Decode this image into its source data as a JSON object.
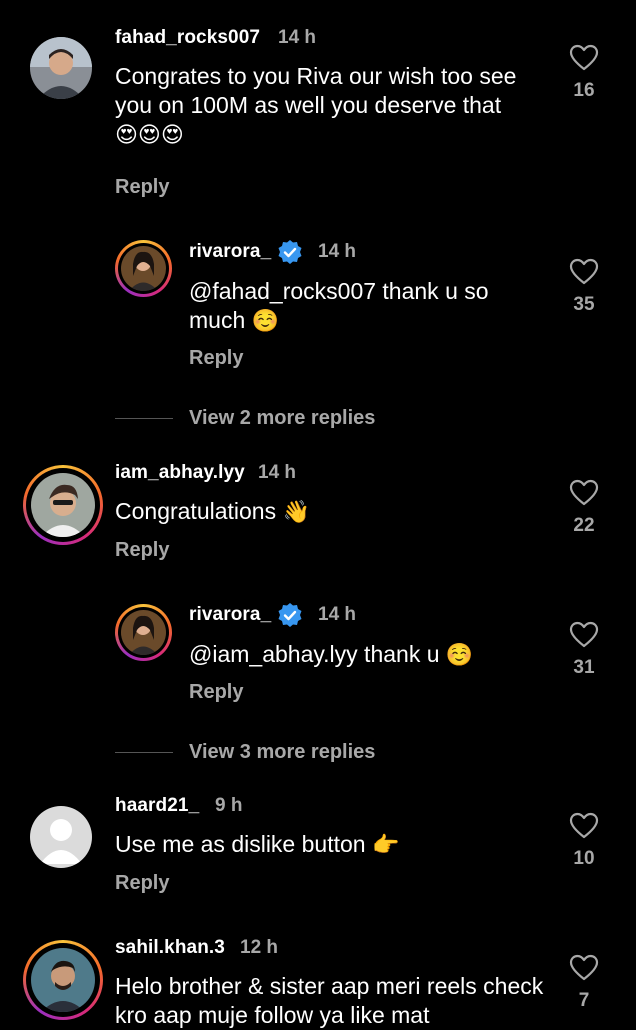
{
  "comments": [
    {
      "username": "fahad_rocks007",
      "time": "14 h",
      "text": "Congrates to you Riva our wish too see you on 100M as well you deserve that",
      "emoji": "😍😍😍",
      "likes": "16",
      "reply_label": "Reply"
    },
    {
      "username": "rivarora_",
      "time": "14 h",
      "text": "@fahad_rocks007 thank u so much",
      "emoji": "☺️",
      "likes": "35",
      "reply_label": "Reply",
      "verified": true
    },
    {
      "view_more": "View 2 more replies"
    },
    {
      "username": "iam_abhay.lyy",
      "time": "14 h",
      "text": "Congratulations",
      "emoji": "👋",
      "likes": "22",
      "reply_label": "Reply"
    },
    {
      "username": "rivarora_",
      "time": "14 h",
      "text": "@iam_abhay.lyy thank u",
      "emoji": "☺️",
      "likes": "31",
      "reply_label": "Reply",
      "verified": true
    },
    {
      "view_more": "View 3 more replies"
    },
    {
      "username": "haard21_",
      "time": "9 h",
      "text": "Use me as dislike button",
      "emoji": "👉",
      "likes": "10",
      "reply_label": "Reply"
    },
    {
      "username": "sahil.khan.3",
      "time": "12 h",
      "text": "Helo brother & sister aap meri reels check kro aap muje follow ya like mat",
      "likes": "7"
    }
  ],
  "colors": {
    "background": "#000000",
    "secondary_text": "#a8a8a8",
    "verified_badge": "#3897f0"
  },
  "icons": {
    "like": "heart-outline-icon",
    "verified": "verified-badge-icon"
  }
}
